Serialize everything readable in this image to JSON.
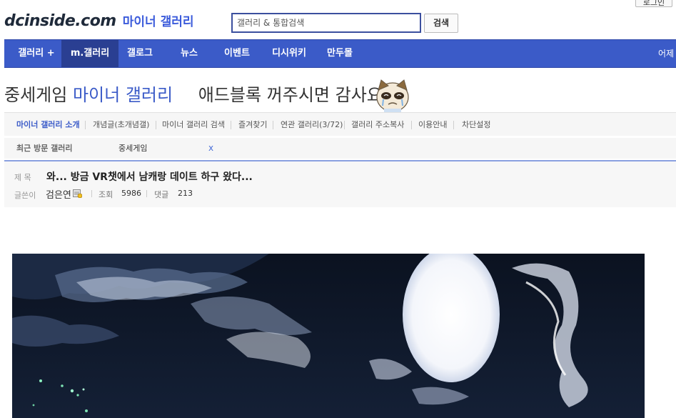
{
  "header": {
    "login_label": "로그인",
    "logo_text": "dcinside.com",
    "logo_subtitle": "마이너 갤러리",
    "search_placeholder": "갤러리 & 통합검색",
    "search_button": "검색"
  },
  "nav": {
    "items": [
      {
        "label": "갤러리 +"
      },
      {
        "label": "m.갤러리"
      },
      {
        "label": "갤로그"
      },
      {
        "label": "뉴스"
      },
      {
        "label": "이벤트"
      },
      {
        "label": "디시위키"
      },
      {
        "label": "만두몰"
      },
      {
        "label": "어제"
      }
    ],
    "active_index": 1
  },
  "gallery": {
    "name": "중세게임",
    "type_label": "마이너 갤러리",
    "adblock_message": "애드블록 꺼주시면 감사요"
  },
  "submenu": {
    "items": [
      {
        "label": "마이너 갤러리 소개"
      },
      {
        "label": "개념글(초개념갤)"
      },
      {
        "label": "마이너 갤러리 검색"
      },
      {
        "label": "즐겨찾기"
      },
      {
        "label": "연관 갤러리(3/72)"
      },
      {
        "label": "갤러리 주소복사"
      },
      {
        "label": "이용안내"
      },
      {
        "label": "차단설정"
      }
    ]
  },
  "recent": {
    "label": "최근 방문 갤러리",
    "items": [
      {
        "label": "중세게임",
        "close": "x"
      }
    ]
  },
  "post": {
    "title_label": "제 목",
    "title": "와... 방금 VR챗에서 남캐랑 데이트 하구 왔다...",
    "author_label": "글쓴이",
    "author": "검은연",
    "views_label": "조회",
    "views": "5986",
    "comments_label": "댓글",
    "comments": "213"
  },
  "colors": {
    "nav_bg": "#3b5bc8",
    "nav_active": "#2a3f92",
    "accent": "#3b5bc8",
    "search_border": "#3b4f9e"
  }
}
